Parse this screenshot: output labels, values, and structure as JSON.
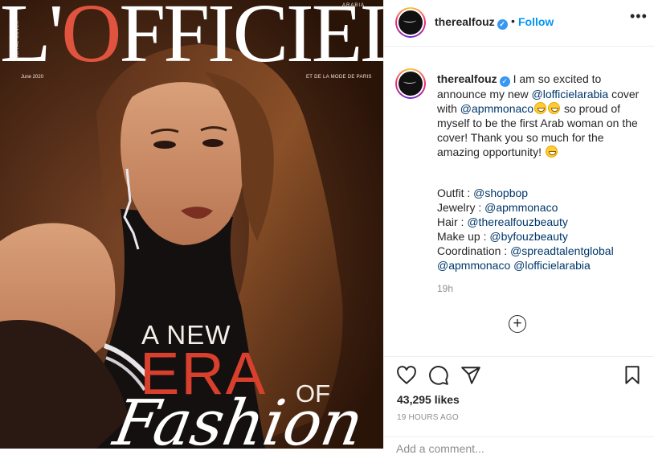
{
  "cover": {
    "masthead_left": "L'",
    "masthead_o": "O",
    "masthead_right": "FFICIEL",
    "arabia": "ARABIA",
    "digital_cover": "DIGITAL COVER",
    "date": "June 2020",
    "tagline": "ET DE LA MODE DE PARIS",
    "line_a_new": "A NEW",
    "line_era": "ERA",
    "line_of": "OF",
    "line_fashion": "Fashion"
  },
  "header": {
    "username": "therealfouz",
    "separator": "•",
    "follow_label": "Follow",
    "more": "•••"
  },
  "caption": {
    "username": "therealfouz",
    "part1": " I am so excited to announce my new ",
    "mention1": "@lofficielarabia",
    "part2": " cover with ",
    "mention2": "@apmmonaco",
    "part3": " so proud of myself to be the first Arab woman on the cover! Thank you so much for the amazing opportunity! "
  },
  "credits": [
    {
      "label": "Outfit : ",
      "mention": "@shopbop"
    },
    {
      "label": "Jewelry : ",
      "mention": "@apmmonaco"
    },
    {
      "label": "Hair : ",
      "mention": "@therealfouzbeauty"
    },
    {
      "label": "Make up : ",
      "mention": "@byfouzbeauty"
    },
    {
      "label": "Coordination : ",
      "mention": "@spreadtalentglobal"
    },
    {
      "label": "",
      "mention": "@apmmonaco @lofficielarabia"
    }
  ],
  "comment_time": "19h",
  "load_more_icon": "plus-circle-icon",
  "actions": {
    "icons": [
      "heart-icon",
      "comment-icon",
      "share-icon",
      "bookmark-icon"
    ],
    "likes": "43,295 likes",
    "time_ago": "19 HOURS AGO"
  },
  "add_comment": {
    "placeholder": "Add a comment..."
  },
  "colors": {
    "follow": "#0095f6",
    "verified": "#3897f0",
    "mention": "#00376b",
    "era": "#d8402d"
  }
}
